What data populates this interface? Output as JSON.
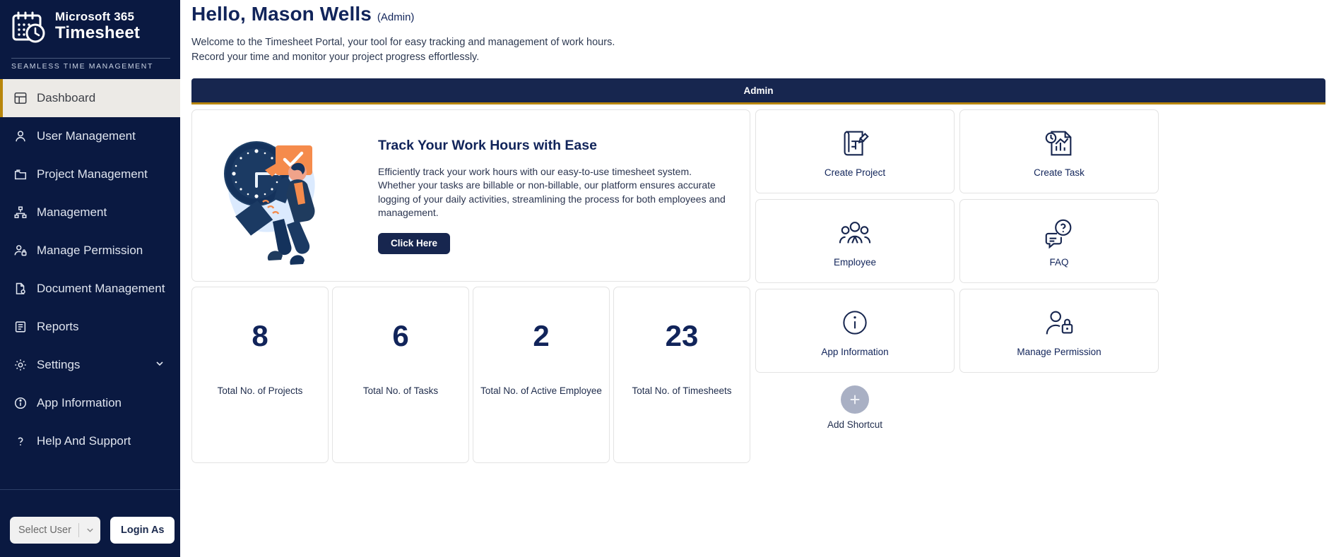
{
  "sidebar": {
    "logo": {
      "line1": "Microsoft 365",
      "line2": "Timesheet",
      "tagline": "SEAMLESS TIME MANAGEMENT",
      "icon": "calendar-clock-icon"
    },
    "items": [
      {
        "label": "Dashboard",
        "icon": "dashboard-grid-icon",
        "active": true,
        "chevron": false
      },
      {
        "label": "User Management",
        "icon": "user-icon",
        "active": false,
        "chevron": false
      },
      {
        "label": "Project Management",
        "icon": "folder-icon",
        "active": false,
        "chevron": false
      },
      {
        "label": "Management",
        "icon": "hierarchy-icon",
        "active": false,
        "chevron": false
      },
      {
        "label": "Manage Permission",
        "icon": "user-lock-icon",
        "active": false,
        "chevron": false
      },
      {
        "label": "Document Management",
        "icon": "document-gear-icon",
        "active": false,
        "chevron": false
      },
      {
        "label": "Reports",
        "icon": "report-icon",
        "active": false,
        "chevron": false
      },
      {
        "label": "Settings",
        "icon": "gear-icon",
        "active": false,
        "chevron": true
      },
      {
        "label": "App Information",
        "icon": "info-circle-icon",
        "active": false,
        "chevron": false
      },
      {
        "label": "Help And Support",
        "icon": "question-mark-icon",
        "active": false,
        "chevron": false
      }
    ],
    "footer": {
      "select_user_label": "Select User",
      "select_user_chevron": "chevron-down-icon",
      "login_as_label": "Login As"
    }
  },
  "header": {
    "greeting": "Hello, Mason Wells",
    "role": "(Admin)",
    "welcome_line1": "Welcome to the Timesheet Portal, your tool for easy tracking and management of work hours.",
    "welcome_line2": "Record your time and monitor your project progress effortlessly."
  },
  "admin_bar": {
    "label": "Admin",
    "accent_color": "#b8860b",
    "background": "#17264f"
  },
  "hero": {
    "illustration": "clock-person-illustration",
    "title": "Track Your Work Hours with Ease",
    "body": "Efficiently track your work hours with our easy-to-use timesheet system. Whether your tasks are billable or non-billable, our platform ensures accurate logging of your daily activities, streamlining the process for both employees and management.",
    "button_label": "Click Here"
  },
  "stats": [
    {
      "value": "8",
      "label": "Total No. of Projects"
    },
    {
      "value": "6",
      "label": "Total No. of Tasks"
    },
    {
      "value": "2",
      "label": "Total No. of Active Employee"
    },
    {
      "value": "23",
      "label": "Total No. of Timesheets"
    }
  ],
  "shortcuts": [
    {
      "label": "Create Project",
      "icon": "blueprint-pencil-icon"
    },
    {
      "label": "Create Task",
      "icon": "task-chart-icon"
    },
    {
      "label": "Employee",
      "icon": "people-group-icon"
    },
    {
      "label": "FAQ",
      "icon": "faq-chat-icon"
    },
    {
      "label": "App Information",
      "icon": "info-circle-icon"
    },
    {
      "label": "Manage Permission",
      "icon": "person-lock-icon"
    }
  ],
  "add_shortcut": {
    "label": "Add Shortcut",
    "icon": "plus-icon"
  },
  "colors": {
    "sidebar_bg": "#0a1941",
    "navy": "#11245a",
    "gold": "#b8860b",
    "orange": "#f58b4c",
    "active_nav_bg": "#eceae6"
  }
}
